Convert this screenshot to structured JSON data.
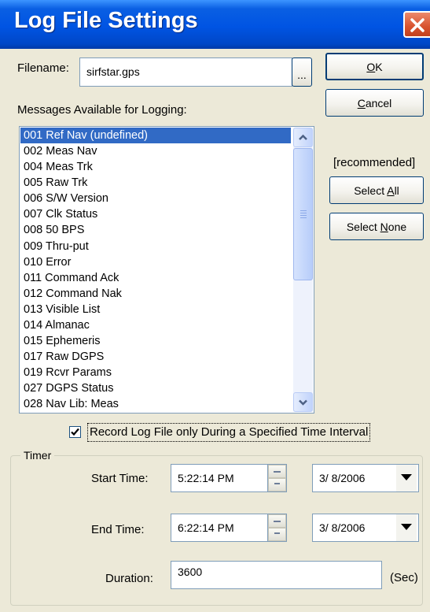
{
  "window": {
    "title": "Log File Settings"
  },
  "filename": {
    "label": "Filename:",
    "value": "sirfstar.gps",
    "browse_label": "..."
  },
  "messages_label": "Messages Available for Logging:",
  "messages": [
    {
      "label": "001  Ref Nav (undefined)",
      "selected": true
    },
    {
      "label": "002  Meas Nav"
    },
    {
      "label": "004  Meas Trk"
    },
    {
      "label": "005  Raw Trk"
    },
    {
      "label": "006  S/W Version"
    },
    {
      "label": "007  Clk Status"
    },
    {
      "label": "008  50 BPS"
    },
    {
      "label": "009  Thru-put"
    },
    {
      "label": "010  Error"
    },
    {
      "label": "011  Command Ack"
    },
    {
      "label": "012  Command Nak"
    },
    {
      "label": "013  Visible List"
    },
    {
      "label": "014  Almanac"
    },
    {
      "label": "015  Ephemeris"
    },
    {
      "label": "017  Raw DGPS"
    },
    {
      "label": "019  Rcvr Params"
    },
    {
      "label": "027  DGPS Status"
    },
    {
      "label": "028  Nav Lib: Meas"
    }
  ],
  "buttons": {
    "ok": "OK",
    "cancel": "Cancel",
    "recommended": "[recommended]",
    "select_all_prefix": "Select ",
    "select_all_key": "A",
    "select_all_suffix": "ll",
    "select_none_prefix": "Select ",
    "select_none_key": "N",
    "select_none_suffix": "one"
  },
  "record_interval": {
    "label": "Record Log File only During a Specified Time Interval",
    "checked": true
  },
  "timer": {
    "caption": "Timer",
    "start_label": "Start Time:",
    "start_time": "5:22:14 PM",
    "start_date": "3/  8/2006",
    "end_label": "End Time:",
    "end_time": "6:22:14 PM",
    "end_date": "3/  8/2006",
    "duration_label": "Duration:",
    "duration_value": "3600",
    "duration_unit": "(Sec)"
  },
  "colors": {
    "title_bar": "#0054e3",
    "selection": "#316ac5",
    "dialog_bg": "#ece9d8",
    "close_button": "#d8522e"
  }
}
